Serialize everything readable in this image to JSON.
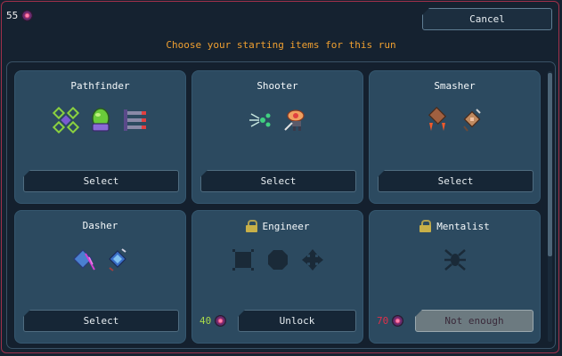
{
  "header": {
    "currency_amount": "55",
    "cancel_label": "Cancel",
    "subtitle": "Choose your starting items for this run"
  },
  "cards": [
    {
      "title": "Pathfinder",
      "button": "Select",
      "locked": false
    },
    {
      "title": "Shooter",
      "button": "Select",
      "locked": false
    },
    {
      "title": "Smasher",
      "button": "Select",
      "locked": false
    },
    {
      "title": "Dasher",
      "button": "Select",
      "locked": false
    },
    {
      "title": "Engineer",
      "button": "Unlock",
      "locked": true,
      "cost": "40"
    },
    {
      "title": "Mentalist",
      "button": "Not enough",
      "locked": true,
      "cost": "70"
    }
  ]
}
